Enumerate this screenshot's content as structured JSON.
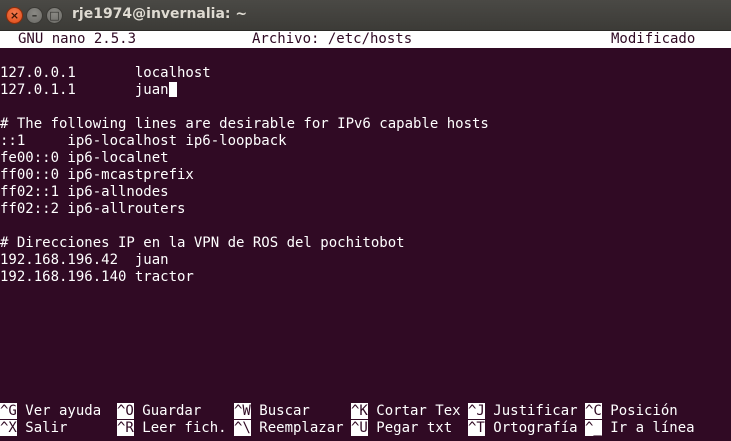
{
  "window": {
    "title": "rje1974@invernalia: ~",
    "close_glyph": "×",
    "minimize_glyph": "–",
    "maximize_glyph": "□"
  },
  "nano": {
    "version": "GNU nano 2.5.3",
    "file": "Archivo: /etc/hosts",
    "status": "Modificado"
  },
  "buffer": {
    "lines": [
      "",
      "127.0.0.1       localhost",
      "127.0.1.1       juan",
      "",
      "# The following lines are desirable for IPv6 capable hosts",
      "::1     ip6-localhost ip6-loopback",
      "fe00::0 ip6-localnet",
      "ff00::0 ip6-mcastprefix",
      "ff02::1 ip6-allnodes",
      "ff02::2 ip6-allrouters",
      "",
      "# Direcciones IP en la VPN de ROS del pochitobot",
      "192.168.196.42  juan",
      "192.168.196.140 tractor"
    ]
  },
  "shortcuts": {
    "row1": [
      {
        "key": "^G",
        "label": " Ver ayuda"
      },
      {
        "key": "^O",
        "label": " Guardar"
      },
      {
        "key": "^W",
        "label": " Buscar"
      },
      {
        "key": "^K",
        "label": " Cortar Tex"
      },
      {
        "key": "^J",
        "label": " Justificar"
      },
      {
        "key": "^C",
        "label": " Posición"
      }
    ],
    "row2": [
      {
        "key": "^X",
        "label": " Salir"
      },
      {
        "key": "^R",
        "label": " Leer fich."
      },
      {
        "key": "^\\",
        "label": " Reemplazar"
      },
      {
        "key": "^U",
        "label": " Pegar txt"
      },
      {
        "key": "^T",
        "label": " Ortografía"
      },
      {
        "key": "^_",
        "label": " Ir a línea"
      }
    ]
  },
  "colors": {
    "terminal_bg": "#300a24",
    "terminal_fg": "#ffffff",
    "titlebar": "#3c3b37",
    "close_button": "#df4a16"
  }
}
